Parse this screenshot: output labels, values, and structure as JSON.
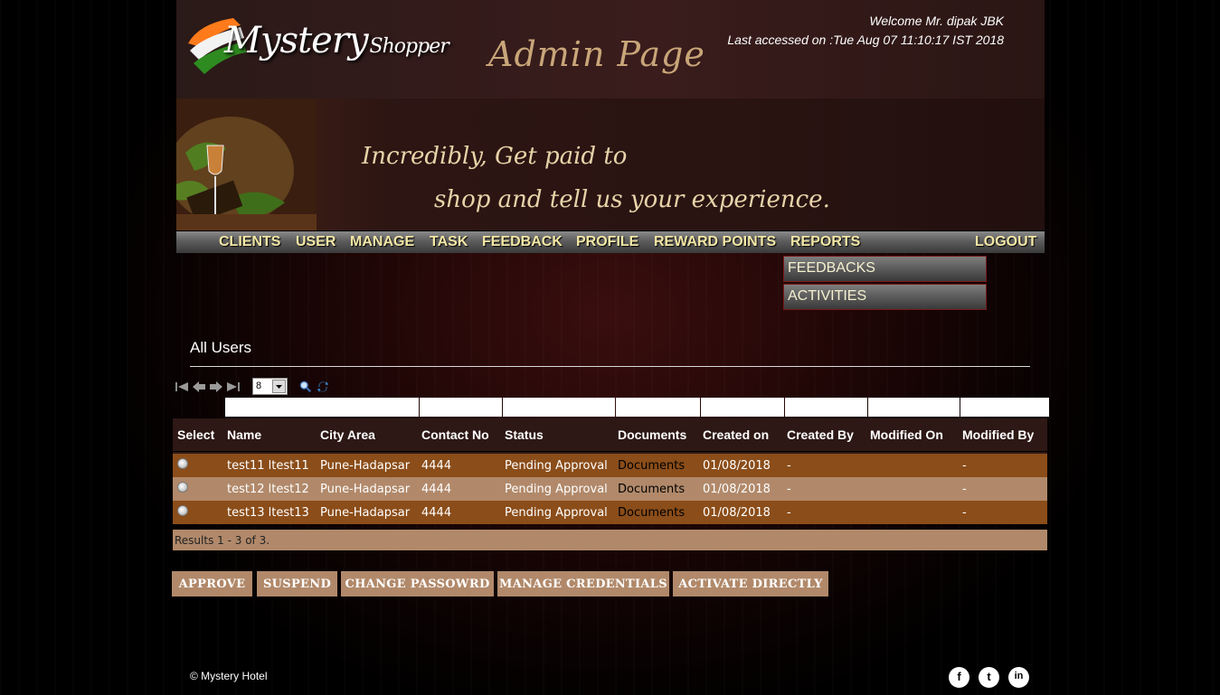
{
  "header": {
    "logo_main": "Mystery",
    "logo_sub": "Shopper",
    "admin_title": "Admin Page",
    "welcome": "Welcome Mr. dipak JBK",
    "last_accessed": "Last accessed on :Tue Aug 07 11:10:17 IST 2018"
  },
  "banner": {
    "tagline_line1": "Incredibly, Get paid to",
    "tagline_line2": "shop and tell us your experience."
  },
  "nav": {
    "items": [
      "CLIENTS",
      "USER",
      "MANAGE",
      "TASK",
      "FEEDBACK",
      "PROFILE",
      "REWARD POINTS",
      "REPORTS"
    ],
    "logout": "LOGOUT",
    "reports_dropdown": [
      "FEEDBACKS",
      "ACTIVITIES"
    ]
  },
  "page": {
    "title": "All Users",
    "page_size": "8"
  },
  "table": {
    "headers": [
      "Select",
      "Name",
      "City Area",
      "Contact No",
      "Status",
      "Documents",
      "Created on",
      "Created By",
      "Modified On",
      "Modified By"
    ],
    "rows": [
      {
        "name": "test11 ltest11",
        "city": "Pune-Hadapsar",
        "contact": "4444",
        "status": "Pending Approval",
        "documents": "Documents",
        "created_on": "01/08/2018",
        "created_by": "-",
        "modified_on": "",
        "modified_by": "-"
      },
      {
        "name": "test12 ltest12",
        "city": "Pune-Hadapsar",
        "contact": "4444",
        "status": "Pending Approval",
        "documents": "Documents",
        "created_on": "01/08/2018",
        "created_by": "-",
        "modified_on": "",
        "modified_by": "-"
      },
      {
        "name": "test13 ltest13",
        "city": "Pune-Hadapsar",
        "contact": "4444",
        "status": "Pending Approval",
        "documents": "Documents",
        "created_on": "01/08/2018",
        "created_by": "-",
        "modified_on": "",
        "modified_by": "-"
      }
    ],
    "results_text": "Results 1 - 3 of 3."
  },
  "actions": [
    "APPROVE",
    "SUSPEND",
    "CHANGE PASSOWRD",
    "MANAGE CREDENTIALS",
    "ACTIVATE DIRECTLY"
  ],
  "footer": {
    "copyright": "© Mystery Hotel",
    "social_icons": [
      "facebook-icon",
      "twitter-icon",
      "linkedin-icon"
    ],
    "social_glyphs": [
      "f",
      "t",
      "in"
    ]
  },
  "colors": {
    "nav_text": "#f3e7a6",
    "row_odd": "#8b4d19",
    "row_even": "#b1896a",
    "header_row": "#2d1815",
    "button": "#b1896a"
  }
}
